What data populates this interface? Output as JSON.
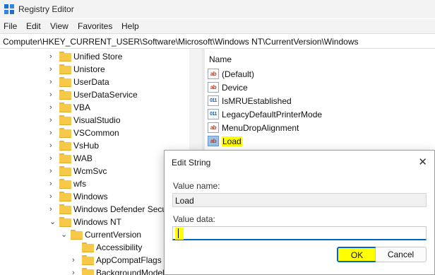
{
  "window": {
    "title": "Registry Editor",
    "icon": "registry-editor-icon"
  },
  "menu": [
    "File",
    "Edit",
    "View",
    "Favorites",
    "Help"
  ],
  "address": "Computer\\HKEY_CURRENT_USER\\Software\\Microsoft\\Windows NT\\CurrentVersion\\Windows",
  "tree": {
    "items": [
      {
        "label": "Unified Store",
        "expanded": false
      },
      {
        "label": "Unistore",
        "expanded": false
      },
      {
        "label": "UserData",
        "expanded": false
      },
      {
        "label": "UserDataService",
        "expanded": false
      },
      {
        "label": "VBA",
        "expanded": false
      },
      {
        "label": "VisualStudio",
        "expanded": false
      },
      {
        "label": "VSCommon",
        "expanded": false
      },
      {
        "label": "VsHub",
        "expanded": false
      },
      {
        "label": "WAB",
        "expanded": false
      },
      {
        "label": "WcmSvc",
        "expanded": false
      },
      {
        "label": "wfs",
        "expanded": false
      },
      {
        "label": "Windows",
        "expanded": false
      },
      {
        "label": "Windows Defender Secur",
        "expanded": false
      },
      {
        "label": "Windows NT",
        "expanded": true
      },
      {
        "label": "CurrentVersion",
        "expanded": true
      },
      {
        "label": "Accessibility",
        "expanded": false
      },
      {
        "label": "AppCompatFlags",
        "expanded": false
      },
      {
        "label": "BackgroundModel",
        "expanded": false
      }
    ]
  },
  "values": {
    "column_name": "Name",
    "items": [
      {
        "name": "(Default)",
        "kind": "sz"
      },
      {
        "name": "Device",
        "kind": "sz"
      },
      {
        "name": "IsMRUEstablished",
        "kind": "bin"
      },
      {
        "name": "LegacyDefaultPrinterMode",
        "kind": "bin"
      },
      {
        "name": "MenuDropAlignment",
        "kind": "sz"
      },
      {
        "name": "Load",
        "kind": "sz"
      }
    ]
  },
  "dialog": {
    "title": "Edit String",
    "close": "✕",
    "value_name_label": "Value name:",
    "value_name": "Load",
    "value_data_label": "Value data:",
    "value_data": "",
    "ok_label": "OK",
    "cancel_label": "Cancel"
  },
  "colors": {
    "highlight": "#ffff00",
    "accent": "#0067c0",
    "folder": "#f7c948"
  }
}
